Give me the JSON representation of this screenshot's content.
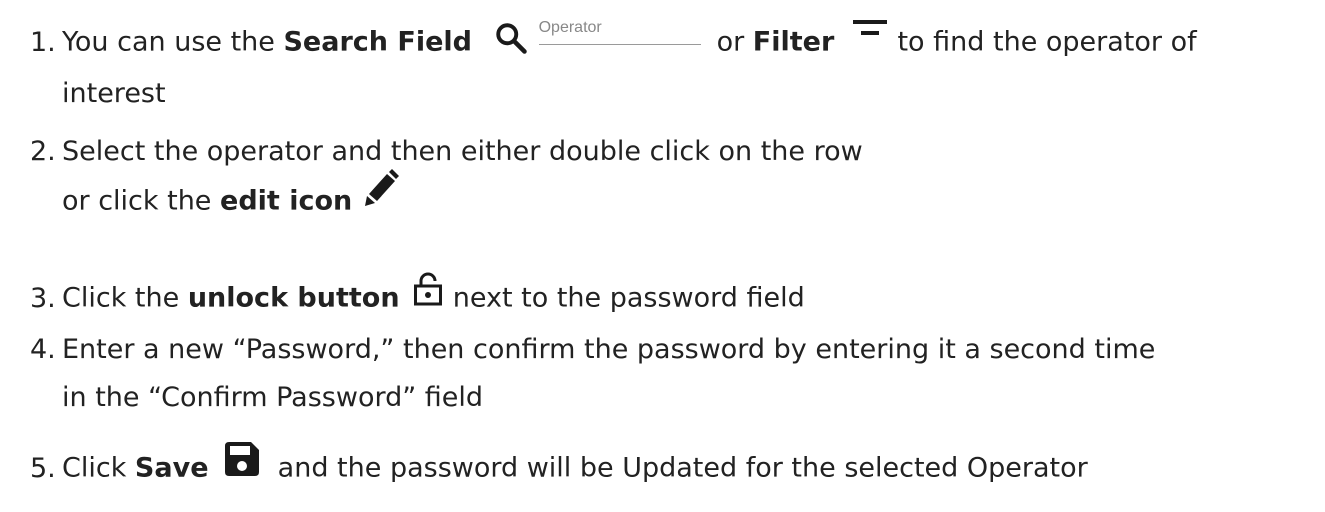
{
  "steps": [
    {
      "number": "1.",
      "intro": "You can use the ",
      "search_field_label": "Search Field",
      "search_placeholder": "Operator",
      "connector": "or ",
      "filter_label": "Filter",
      "tail": " to find the operator of",
      "continuation": "interest",
      "icons": [
        "search-icon",
        "filter-icon"
      ]
    },
    {
      "number": "2.",
      "line1": "Select the operator and then either double click on the row",
      "line2_pre": "or click the ",
      "edit_label": "edit icon",
      "icons": [
        "pencil-icon"
      ]
    },
    {
      "number": "3.",
      "pre": "Click the ",
      "unlock_label": "unlock button",
      "post": " next to the password field",
      "icons": [
        "unlock-icon"
      ]
    },
    {
      "number": "4.",
      "line1": "Enter a new “Password,” then confirm the password by entering it a second time",
      "line2": "in the “Confirm Password” field"
    },
    {
      "number": "5.",
      "pre": "Click ",
      "save_label": "Save",
      "post": " and the password will be Updated for the selected Operator",
      "icons": [
        "save-icon"
      ]
    }
  ]
}
